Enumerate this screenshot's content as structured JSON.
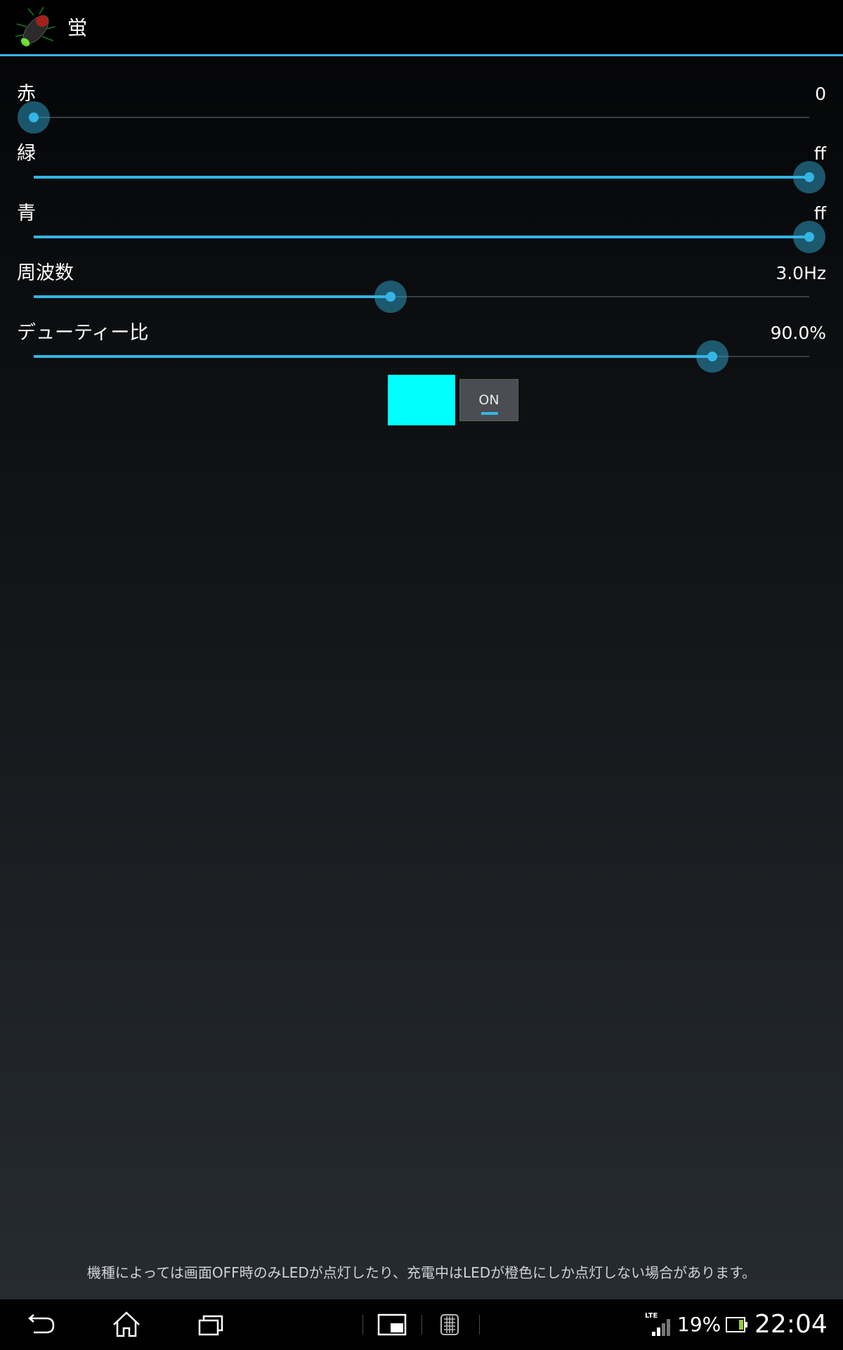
{
  "app": {
    "title": "蛍",
    "icon": "firefly-icon"
  },
  "sliders": [
    {
      "label": "赤",
      "value_text": "0",
      "fraction": 0.0
    },
    {
      "label": "緑",
      "value_text": "ff",
      "fraction": 1.0
    },
    {
      "label": "青",
      "value_text": "ff",
      "fraction": 1.0
    },
    {
      "label": "周波数",
      "value_text": "3.0Hz",
      "fraction": 0.46
    },
    {
      "label": "デューティー比",
      "value_text": "90.0%",
      "fraction": 0.875
    }
  ],
  "swatch": {
    "color": "#00ffff"
  },
  "toggle": {
    "label": "ON",
    "state": true
  },
  "footer": {
    "note": "機種によっては画面OFF時のみLEDが点灯したり、充電中はLEDが橙色にしか点灯しない場合があります。"
  },
  "status": {
    "network": "LTE",
    "battery_percent": "19%",
    "time": "22:04"
  },
  "nav": {
    "icons": [
      "back-icon",
      "home-icon",
      "recents-icon",
      "small-app-icon",
      "keyboard-icon",
      "signal-icon",
      "battery-icon"
    ]
  },
  "colors": {
    "accent": "#33b5e5",
    "swatch": "#00ffff"
  }
}
